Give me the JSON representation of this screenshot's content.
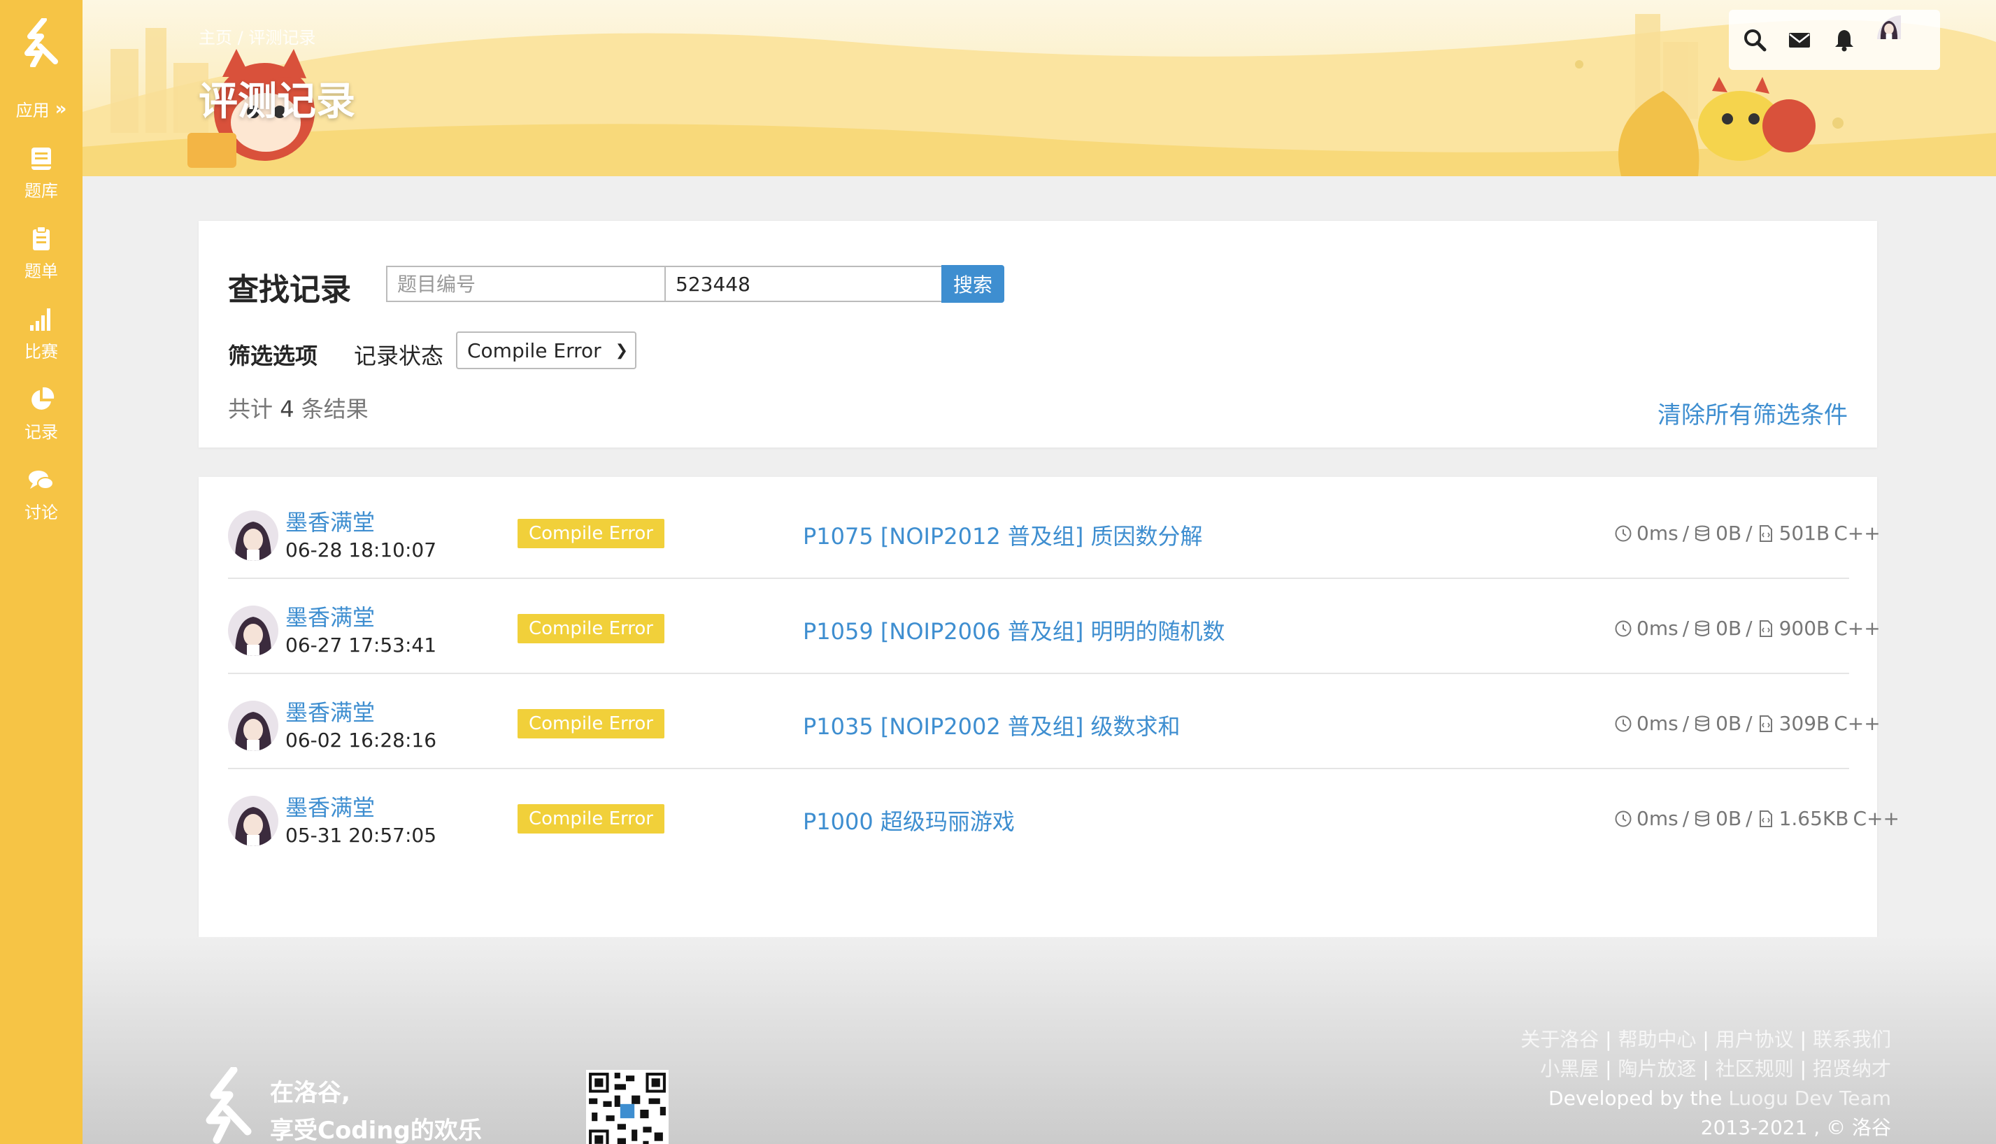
{
  "sidebar": {
    "apps_label": "应用",
    "items": [
      {
        "label": "题库",
        "icon": "book-icon"
      },
      {
        "label": "题单",
        "icon": "clipboard-icon"
      },
      {
        "label": "比赛",
        "icon": "bar-chart-icon"
      },
      {
        "label": "记录",
        "icon": "pie-chart-icon"
      },
      {
        "label": "讨论",
        "icon": "comments-icon"
      }
    ]
  },
  "header": {
    "breadcrumb": "主页 / 评测记录",
    "title": "评测记录"
  },
  "search": {
    "title": "查找记录",
    "problem_placeholder": "题目编号",
    "user_value": "523448",
    "button": "搜索",
    "filter_label": "筛选选项",
    "status_label": "记录状态",
    "status_value": "Compile Error",
    "total_prefix": "共计",
    "total_count": "4",
    "total_suffix": "条结果",
    "clear": "清除所有筛选条件"
  },
  "records": [
    {
      "user": "墨香满堂",
      "time": "06-28 18:10:07",
      "status": "Compile Error",
      "problem": "P1075 [NOIP2012 普及组] 质因数分解",
      "time_used": "0ms",
      "memory": "0B",
      "code_size": "501B",
      "lang": "C++"
    },
    {
      "user": "墨香满堂",
      "time": "06-27 17:53:41",
      "status": "Compile Error",
      "problem": "P1059 [NOIP2006 普及组] 明明的随机数",
      "time_used": "0ms",
      "memory": "0B",
      "code_size": "900B",
      "lang": "C++"
    },
    {
      "user": "墨香满堂",
      "time": "06-02 16:28:16",
      "status": "Compile Error",
      "problem": "P1035 [NOIP2002 普及组] 级数求和",
      "time_used": "0ms",
      "memory": "0B",
      "code_size": "309B",
      "lang": "C++"
    },
    {
      "user": "墨香满堂",
      "time": "05-31 20:57:05",
      "status": "Compile Error",
      "problem": "P1000 超级玛丽游戏",
      "time_used": "0ms",
      "memory": "0B",
      "code_size": "1.65KB",
      "lang": "C++"
    }
  ],
  "footer": {
    "slogan_line1": "在洛谷,",
    "slogan_line2": "享受Coding的欢乐",
    "links_line1": [
      "关于洛谷",
      "帮助中心",
      "用户协议",
      "联系我们"
    ],
    "links_line2": [
      "小黑屋",
      "陶片放逐",
      "社区规则",
      "招贤纳才"
    ],
    "dev_prefix": "Developed by the",
    "dev_team": "Luogu Dev Team",
    "copyright": "2013-2021 , © 洛谷"
  },
  "colors": {
    "brand_yellow": "#f6c445",
    "link_blue": "#3e8ed0",
    "status_yellow": "#f1d03a"
  }
}
